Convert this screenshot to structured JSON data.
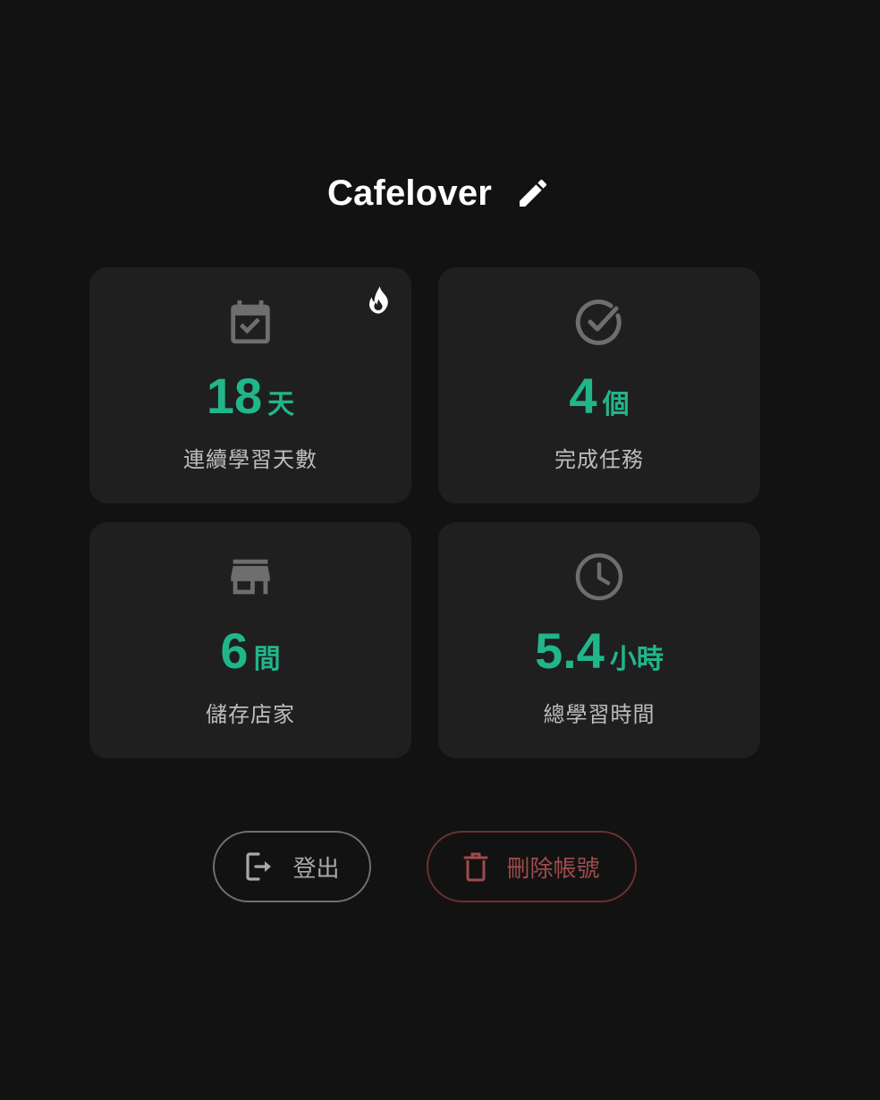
{
  "profile": {
    "username": "Cafelover"
  },
  "stats": [
    {
      "value": "18",
      "unit": "天",
      "label": "連續學習天數",
      "icon": "calendar-check-icon",
      "badge": "flame-icon"
    },
    {
      "value": "4",
      "unit": "個",
      "label": "完成任務",
      "icon": "check-circle-icon"
    },
    {
      "value": "6",
      "unit": "間",
      "label": "儲存店家",
      "icon": "store-icon"
    },
    {
      "value": "5.4",
      "unit": "小時",
      "label": "總學習時間",
      "icon": "clock-icon"
    }
  ],
  "actions": {
    "logout_label": "登出",
    "delete_label": "刪除帳號"
  },
  "colors": {
    "background": "#121212",
    "card": "#1f1f1f",
    "accent": "#21b68a",
    "icon": "#6e6e6e",
    "danger": "#a04b4b"
  }
}
